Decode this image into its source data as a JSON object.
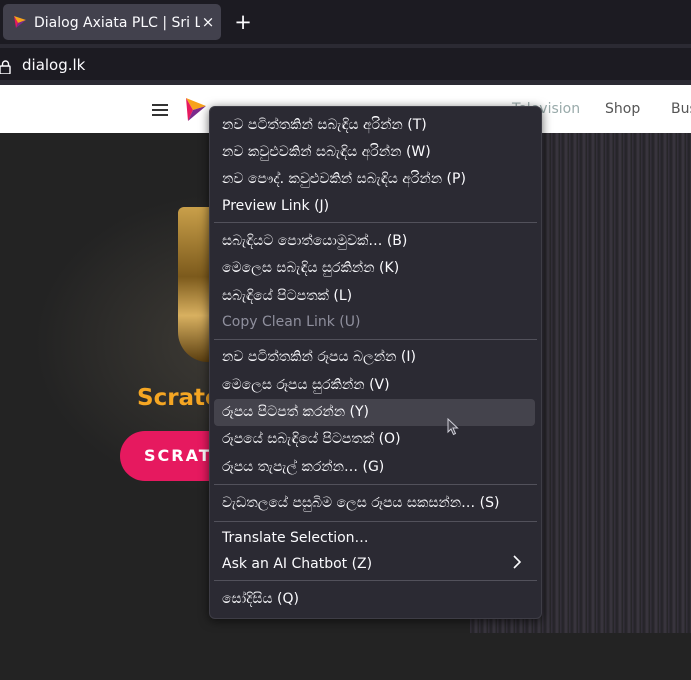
{
  "browser": {
    "tab_title": "Dialog Axiata PLC | Sri Lanka",
    "tab_close": "×",
    "new_tab": "+",
    "url": "dialog.lk"
  },
  "site": {
    "nav_faded": "Television",
    "nav_shop": "Shop",
    "nav_business": "Bus",
    "hero_text": "Scratc",
    "hero_button": "SCRATC"
  },
  "context_menu": {
    "items": [
      {
        "label": "නව පටිත්තකින් සබැඳිය අරින්න (T)"
      },
      {
        "label": "නව කවුළුවකින් සබැඳිය අරින්න (W)"
      },
      {
        "label": "නව පෞද්. කවුළුවකින් සබැඳිය අරින්න (P)"
      },
      {
        "label": "Preview Link (J)"
      },
      {
        "label": "සබැඳියට පොත්යොමුවක්… (B)"
      },
      {
        "label": "මෙලෙස සබැඳිය සුරකින්න (K)"
      },
      {
        "label": "සබැඳියේ පිටපතක් (L)"
      },
      {
        "label": "Copy Clean Link (U)",
        "disabled": true
      },
      {
        "label": "නව පටිත්තකින් රූපය බලන්න (I)"
      },
      {
        "label": "මෙලෙස රූපය සුරකින්න (V)"
      },
      {
        "label": "රූපය පිටපත් කරන්න (Y)",
        "highlighted": true
      },
      {
        "label": "රූපයේ සබැඳියේ පිටපතක් (O)"
      },
      {
        "label": "රූපය තැපැල් කරන්න… (G)"
      },
      {
        "label": "වැඩතලයේ පසුබිම ලෙස රූපය සකසන්න… (S)"
      },
      {
        "label": "Translate Selection…"
      },
      {
        "label": "Ask an AI Chatbot (Z)"
      },
      {
        "label": "සෝදිසිය (Q)"
      }
    ]
  },
  "colors": {
    "menu_bg": "#2b2a33",
    "highlight": "#44434c",
    "brand_pink": "#e6195f",
    "hero_gold": "#f5a623"
  },
  "icons": [
    "favicon-icon",
    "close-icon",
    "plus-icon",
    "lock-icon",
    "hamburger-icon",
    "dialog-logo-icon",
    "chevron-right-icon",
    "mouse-cursor-icon"
  ]
}
